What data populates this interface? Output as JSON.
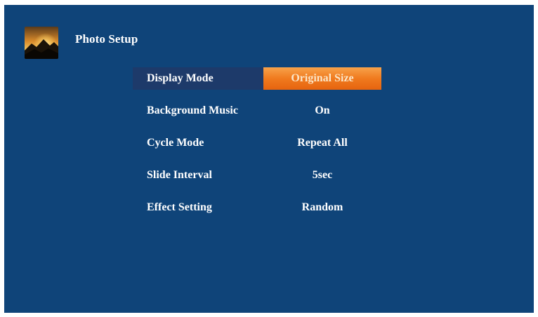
{
  "screen": {
    "title": "Photo Setup",
    "icon": "photo-landscape-icon",
    "background_color": "#0f4479",
    "highlight_color": "#f07a1e"
  },
  "menu": {
    "items": [
      {
        "label": "Display Mode",
        "value": "Original Size",
        "selected": true
      },
      {
        "label": "Background Music",
        "value": "On",
        "selected": false
      },
      {
        "label": "Cycle Mode",
        "value": "Repeat All",
        "selected": false
      },
      {
        "label": "Slide Interval",
        "value": "5sec",
        "selected": false
      },
      {
        "label": "Effect Setting",
        "value": "Random",
        "selected": false
      }
    ]
  }
}
